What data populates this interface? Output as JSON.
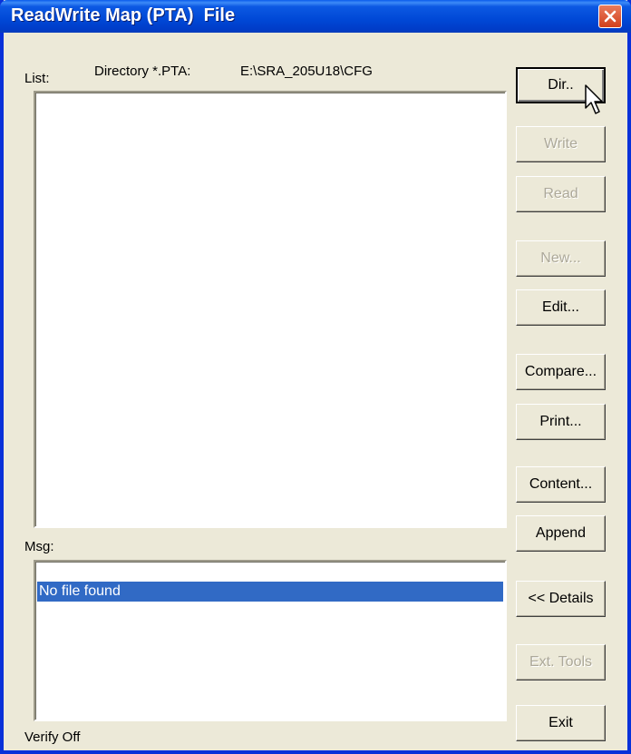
{
  "window": {
    "title": "ReadWrite Map (PTA)  File"
  },
  "header": {
    "list_label": "List:",
    "directory_label": "Directory *.PTA:",
    "directory_path": "E:\\SRA_205U18\\CFG"
  },
  "list": {
    "items": []
  },
  "msg": {
    "label": "Msg:",
    "selected_message": "No file found"
  },
  "status": {
    "verify": "Verify Off"
  },
  "buttons": {
    "dir": "Dir..",
    "write": "Write",
    "read": "Read",
    "new": "New...",
    "edit": "Edit...",
    "compare": "Compare...",
    "print": "Print...",
    "content": "Content...",
    "append": "Append",
    "details": "<< Details",
    "ext_tools": "Ext. Tools",
    "exit": "Exit"
  },
  "colors": {
    "titlebar": "#0054E3",
    "selection": "#316AC5",
    "dialog_bg": "#ECE9D8",
    "close_button": "#D2401C"
  },
  "icons": {
    "close": "close-icon",
    "cursor": "mouse-pointer-icon"
  }
}
